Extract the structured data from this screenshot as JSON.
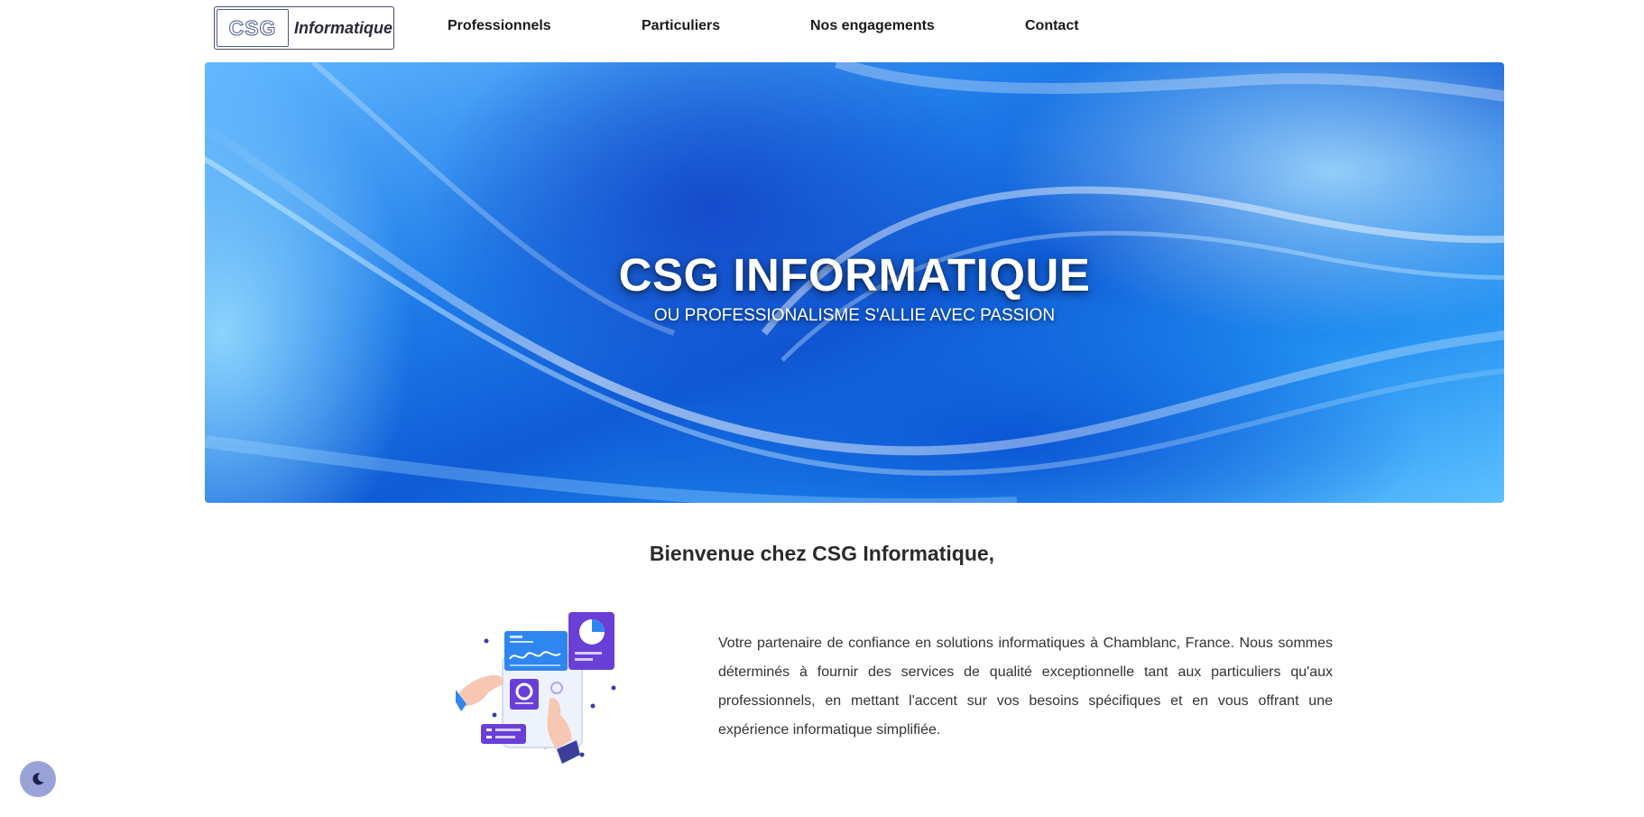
{
  "brand": {
    "mark": "CSG",
    "wordmark": "Informatique"
  },
  "nav": {
    "items": [
      {
        "label": "Professionnels"
      },
      {
        "label": "Particuliers"
      },
      {
        "label": "Nos engagements"
      },
      {
        "label": "Contact"
      }
    ]
  },
  "hero": {
    "title": "CSG INFORMATIQUE",
    "subtitle": "OU PROFESSIONALISME S'ALLIE AVEC PASSION"
  },
  "welcome": {
    "heading": "Bienvenue chez CSG Informatique,",
    "text": "Votre partenaire de confiance en solutions informatiques à Chamblanc, France. Nous sommes déterminés à fournir des services de qualité exceptionnelle tant aux particuliers qu'aux professionnels, en mettant l'accent sur vos besoins spécifiques et en vous offrant une expérience informatique simplifiée."
  },
  "icons": {
    "theme_toggle": "moon-icon"
  },
  "colors": {
    "hero_blue": "#1e7be8",
    "illustration_purple": "#6a3fd8",
    "illustration_blue": "#2f86f0",
    "toggle_bg": "#9aa3d8"
  }
}
